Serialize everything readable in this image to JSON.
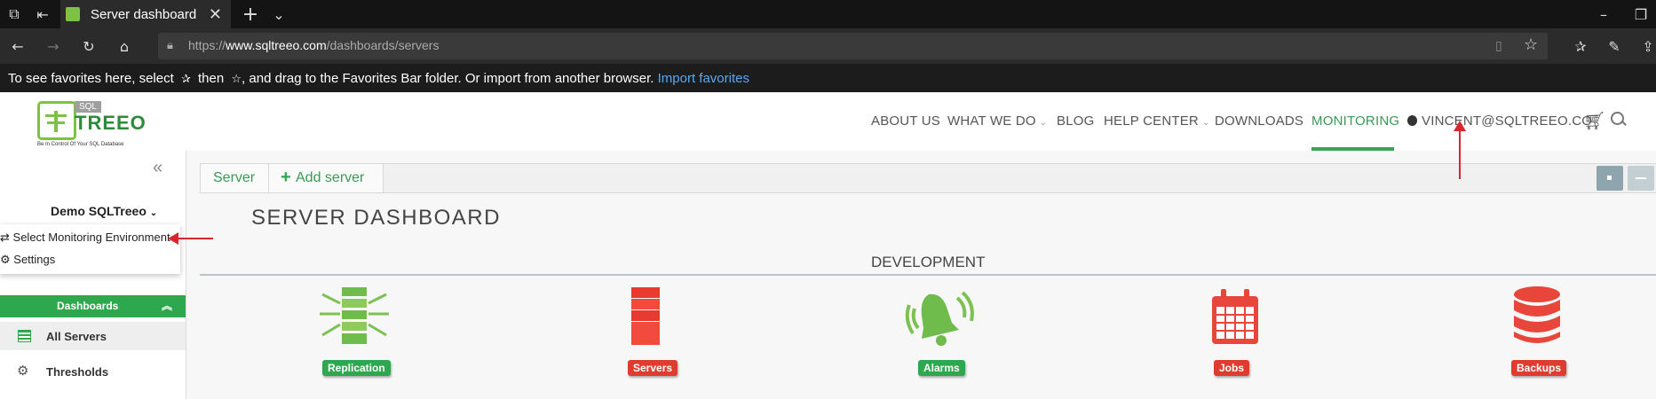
{
  "browser": {
    "tab_title": "Server dashboard",
    "url_prefix": "https://",
    "url_domain": "www.sqltreeo.com",
    "url_path": "/dashboards/servers",
    "favorites_text_1": "To see favorites here, select",
    "favorites_text_2": "then",
    "favorites_text_3": ", and drag to the Favorites Bar folder. Or import from another browser.",
    "import_link": "Import favorites"
  },
  "site": {
    "logo_top": "SQL",
    "logo_name": "TREEO",
    "logo_tagline": "Be In Control Of Your SQL Database",
    "nav": [
      "ABOUT US",
      "WHAT WE DO",
      "BLOG",
      "HELP CENTER",
      "DOWNLOADS",
      "MONITORING",
      "VINCENT@SQLTREEO.CO"
    ],
    "active_nav": "MONITORING"
  },
  "sidebar": {
    "collapse": "«",
    "environment": "Demo SQLTreeo",
    "menu": [
      "Select Monitoring Environment",
      "Settings"
    ],
    "section": "Dashboards",
    "items": [
      "All Servers",
      "Thresholds"
    ]
  },
  "toolbar": {
    "server_tab": "Server",
    "add_server": "Add server"
  },
  "dashboard": {
    "title": "SERVER DASHBOARD",
    "group": "DEVELOPMENT",
    "tiles": [
      "Replication",
      "Servers",
      "Alarms",
      "Jobs",
      "Backups"
    ]
  },
  "colors": {
    "green": "#2aa74e",
    "red": "#e03b2f",
    "nav_active": "#3aa655"
  }
}
